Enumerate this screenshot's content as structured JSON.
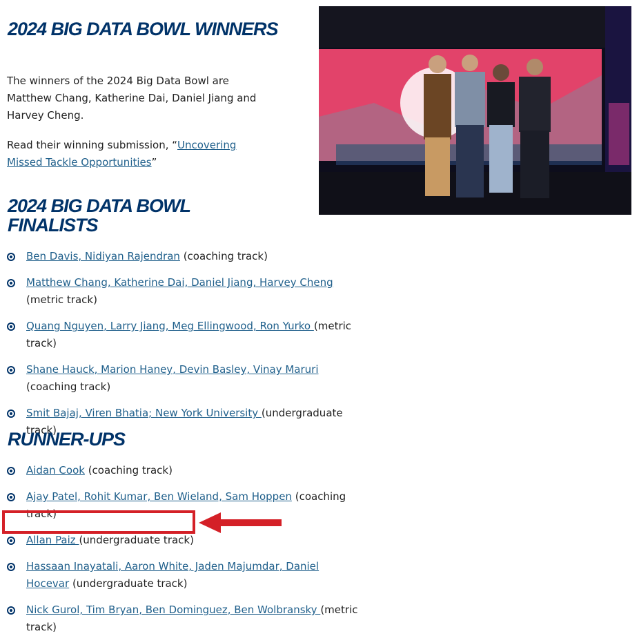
{
  "winners": {
    "heading": "2024 BIG DATA BOWL WINNERS",
    "description": "The winners of the 2024 Big Data Bowl are Matthew Chang, Katherine Dai, Daniel Jiang and Harvey Cheng.",
    "read_prefix": "Read their winning submission, “",
    "read_link": "Uncovering Missed Tackle Opportunities",
    "read_suffix": "”"
  },
  "finalists": {
    "heading": "2024 BIG DATA BOWL FINALISTS",
    "items": [
      {
        "link": "Ben Davis, Nidiyan Rajendran",
        "track": " (coaching track)"
      },
      {
        "link": "Matthew Chang, Katherine Dai, Daniel Jiang, Harvey Cheng",
        "track": " (metric track)"
      },
      {
        "link": "Quang Nguyen, Larry Jiang, Meg Ellingwood, Ron Yurko ",
        "track": "(metric track)"
      },
      {
        "link": "Shane Hauck, Marion Haney, Devin Basley, Vinay Maruri",
        "track": " (coaching track)"
      },
      {
        "link": "Smit Bajaj, Viren Bhatia; New York University ",
        "track": "(undergraduate track)"
      }
    ]
  },
  "runner_ups": {
    "heading": "RUNNER-UPS",
    "items": [
      {
        "link": "Aidan Cook",
        "track": " (coaching track)"
      },
      {
        "link": "Ajay Patel, Rohit Kumar, Ben Wieland, Sam Hoppen",
        "track": " (coaching track)"
      },
      {
        "link": "Allan Paiz ",
        "track": "(undergraduate track)"
      },
      {
        "link": "Hassaan Inayatali, Aaron White, Jaden Majumdar, Daniel Hocevar",
        "track": " (undergraduate track)"
      },
      {
        "link": "Nick Gurol, Tim Bryan, Ben Dominguez, Ben Wolbransky ",
        "track": "(metric track)"
      }
    ]
  },
  "colors": {
    "heading": "#013369",
    "link": "#1f5f8b",
    "highlight": "#d42027"
  },
  "photo": {
    "icon": "winners-photo"
  }
}
